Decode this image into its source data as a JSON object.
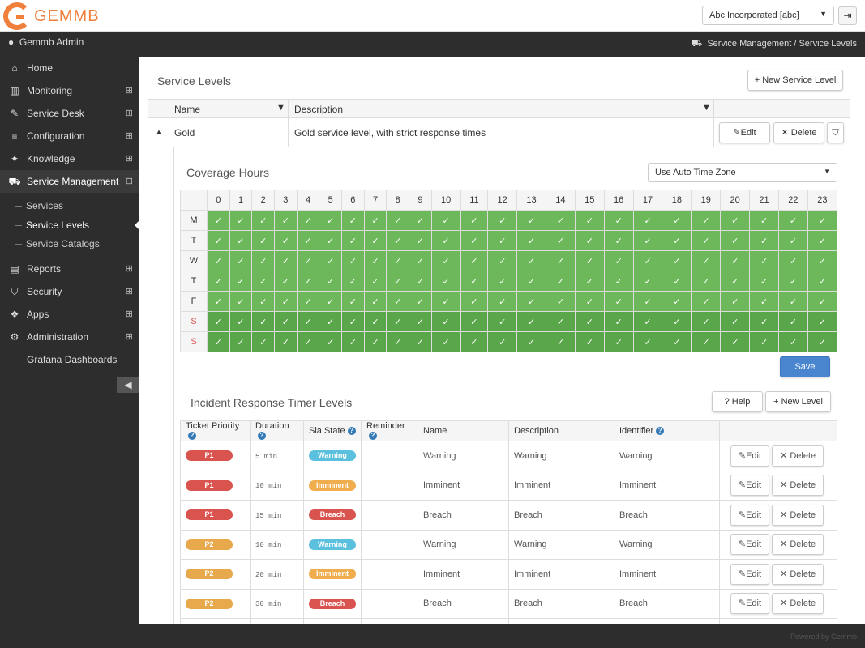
{
  "app": {
    "logo_text": "GEMMB",
    "tenant": "Abc Incorporated [abc]",
    "user": "Gemmb Admin",
    "breadcrumb": "Service Management / Service Levels",
    "footer": "Powered by Gemmb"
  },
  "nav": [
    {
      "label": "Home",
      "icon": "home-icon",
      "glyph": "⌂",
      "expandable": false
    },
    {
      "label": "Monitoring",
      "icon": "bar-chart-icon",
      "glyph": "▥",
      "expandable": true
    },
    {
      "label": "Service Desk",
      "icon": "ticket-icon",
      "glyph": "✎",
      "expandable": true
    },
    {
      "label": "Configuration",
      "icon": "database-icon",
      "glyph": "≡",
      "expandable": true
    },
    {
      "label": "Knowledge",
      "icon": "lightbulb-icon",
      "glyph": "✦",
      "expandable": true
    },
    {
      "label": "Service Management",
      "icon": "cart-icon",
      "glyph": "⛟",
      "expandable": true,
      "expanded": true
    },
    {
      "label": "Reports",
      "icon": "book-icon",
      "glyph": "▤",
      "expandable": true
    },
    {
      "label": "Security",
      "icon": "shield-icon",
      "glyph": "⛉",
      "expandable": true
    },
    {
      "label": "Apps",
      "icon": "cubes-icon",
      "glyph": "❖",
      "expandable": true
    },
    {
      "label": "Administration",
      "icon": "gear-icon",
      "glyph": "⚙",
      "expandable": true
    },
    {
      "label": "Grafana Dashboards",
      "icon": "",
      "glyph": "",
      "expandable": false
    }
  ],
  "subnav": [
    "Services",
    "Service Levels",
    "Service Catalogs"
  ],
  "page": {
    "title": "Service Levels",
    "new_button": "New Service Level",
    "columns": {
      "name": "Name",
      "description": "Description"
    },
    "row": {
      "name": "Gold",
      "description": "Gold service level, with strict response times"
    },
    "row_edit": "Edit",
    "row_delete": "Delete"
  },
  "coverage": {
    "title": "Coverage Hours",
    "timezone": "Use Auto Time Zone",
    "hours": [
      "0",
      "1",
      "2",
      "3",
      "4",
      "5",
      "6",
      "7",
      "8",
      "9",
      "10",
      "11",
      "12",
      "13",
      "14",
      "15",
      "16",
      "17",
      "18",
      "19",
      "20",
      "21",
      "22",
      "23"
    ],
    "days": [
      "M",
      "T",
      "W",
      "T",
      "F",
      "S",
      "S"
    ],
    "weekend_color": "#d9534f",
    "check": "✓",
    "save": "Save"
  },
  "incident": {
    "title": "Incident Response Timer Levels",
    "help": "Help",
    "new_level": "New Level",
    "headers": [
      "Ticket Priority",
      "Duration",
      "Sla State",
      "Reminder",
      "Name",
      "Description",
      "Identifier"
    ],
    "edit": "Edit",
    "delete": "Delete",
    "rows": [
      {
        "priority": "P1",
        "duration": "5 min",
        "state": "Warning",
        "name": "Warning",
        "description": "Warning",
        "identifier": "Warning"
      },
      {
        "priority": "P1",
        "duration": "10 min",
        "state": "Imminent",
        "name": "Imminent",
        "description": "Imminent",
        "identifier": "Imminent"
      },
      {
        "priority": "P1",
        "duration": "15 min",
        "state": "Breach",
        "name": "Breach",
        "description": "Breach",
        "identifier": "Breach"
      },
      {
        "priority": "P2",
        "duration": "10 min",
        "state": "Warning",
        "name": "Warning",
        "description": "Warning",
        "identifier": "Warning"
      },
      {
        "priority": "P2",
        "duration": "20 min",
        "state": "Imminent",
        "name": "Imminent",
        "description": "Imminent",
        "identifier": "Imminent"
      },
      {
        "priority": "P2",
        "duration": "30 min",
        "state": "Breach",
        "name": "Breach",
        "description": "Breach",
        "identifier": "Breach"
      }
    ],
    "colors": {
      "P1": "#d9534f",
      "P2": "#e8a84c",
      "Warning": "#5bc0de",
      "Imminent": "#f0ad4e",
      "Breach": "#d9534f"
    }
  }
}
